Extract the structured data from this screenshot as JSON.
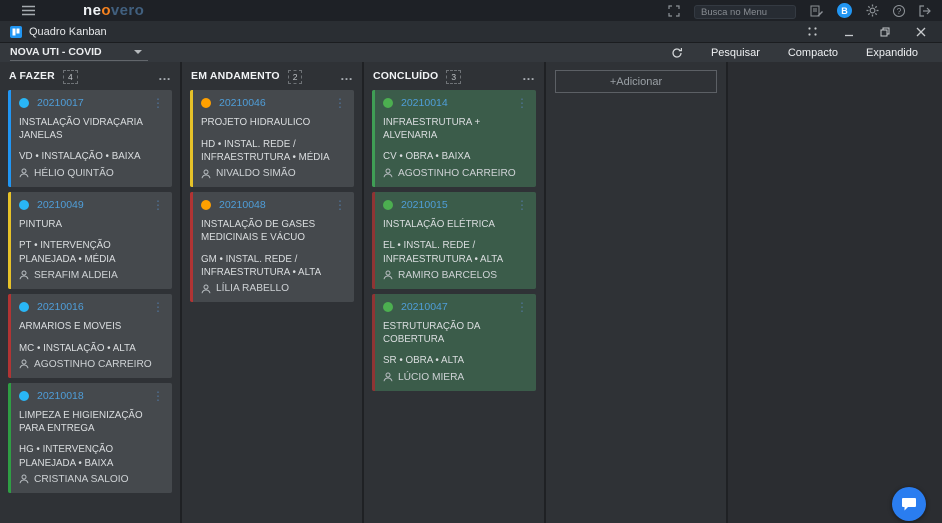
{
  "topbar": {
    "logo": {
      "prefix": "ne",
      "accent": "o",
      "suffix": "vero"
    },
    "search_placeholder": "Busca no Menu",
    "avatar_initial": "B"
  },
  "tabbar": {
    "tab_label": "Quadro Kanban"
  },
  "toolbar": {
    "board_selector": "NOVA UTI - COVID",
    "refresh_label": "",
    "search_label": "Pesquisar",
    "compact_label": "Compacto",
    "expanded_label": "Expandido"
  },
  "icons": {
    "card_menu": "⋮",
    "column_menu": "…",
    "help": "?"
  },
  "colors": {
    "accent_blue": "#2196f3",
    "logo_orange": "#f5821f",
    "status_blue": "#29b6f6",
    "status_orange": "#ffa000",
    "status_green": "#4caf50",
    "priority_yellow": "#e6c229",
    "priority_red": "#b13434",
    "done_card_bg": "#3b5c4a",
    "chat_blue": "#2a7df0"
  },
  "board": {
    "add_label": "+Adicionar",
    "columns": [
      {
        "title": "A FAZER",
        "count": "4",
        "cards": [
          {
            "id": "20210017",
            "dot": "#29b6f6",
            "border": "#2196f3",
            "title": "INSTALAÇÃO VIDRAÇARIA JANELAS",
            "meta": "VD • INSTALAÇÃO • BAIXA",
            "assignee": "HÉLIO QUINTÃO"
          },
          {
            "id": "20210049",
            "dot": "#29b6f6",
            "border": "#e6c229",
            "title": "PINTURA",
            "meta": "PT • INTERVENÇÃO PLANEJADA • MÉDIA",
            "assignee": "SERAFIM ALDEIA"
          },
          {
            "id": "20210016",
            "dot": "#29b6f6",
            "border": "#b13434",
            "title": "ARMARIOS E MOVEIS",
            "meta": "MC • INSTALAÇÃO • ALTA",
            "assignee": "AGOSTINHO CARREIRO"
          },
          {
            "id": "20210018",
            "dot": "#29b6f6",
            "border": "#2f9e44",
            "title": "LIMPEZA E HIGIENIZAÇÃO PARA ENTREGA",
            "meta": "HG • INTERVENÇÃO PLANEJADA • BAIXA",
            "assignee": "CRISTIANA SALOIO"
          }
        ]
      },
      {
        "title": "EM ANDAMENTO",
        "count": "2",
        "cards": [
          {
            "id": "20210046",
            "dot": "#ffa000",
            "border": "#e6c229",
            "title": "PROJETO HIDRAULICO",
            "meta": "HD • INSTAL. REDE / INFRAESTRUTURA • MÉDIA",
            "assignee": "NIVALDO SIMÃO"
          },
          {
            "id": "20210048",
            "dot": "#ffa000",
            "border": "#b13434",
            "title": "INSTALAÇÃO DE GASES MEDICINAIS E VÁCUO",
            "meta": "GM • INSTAL. REDE / INFRAESTRUTURA • ALTA",
            "assignee": "LÍLIA RABELLO"
          }
        ]
      },
      {
        "title": "CONCLUÍDO",
        "count": "3",
        "cards": [
          {
            "id": "20210014",
            "dot": "#4caf50",
            "border": "#3f9e55",
            "bg": "#3b5c4a",
            "title": "INFRAESTRUTURA + ALVENARIA",
            "meta": "CV • OBRA • BAIXA",
            "assignee": "AGOSTINHO CARREIRO"
          },
          {
            "id": "20210015",
            "dot": "#4caf50",
            "border": "#8f3434",
            "bg": "#3b5c4a",
            "title": "INSTALAÇÃO ELÉTRICA",
            "meta": "EL • INSTAL. REDE / INFRAESTRUTURA • ALTA",
            "assignee": "RAMIRO BARCELOS"
          },
          {
            "id": "20210047",
            "dot": "#4caf50",
            "border": "#8f3434",
            "bg": "#3b5c4a",
            "title": "ESTRUTURAÇÃO DA COBERTURA",
            "meta": "SR • OBRA • ALTA",
            "assignee": "LÚCIO MIERA"
          }
        ]
      }
    ]
  }
}
